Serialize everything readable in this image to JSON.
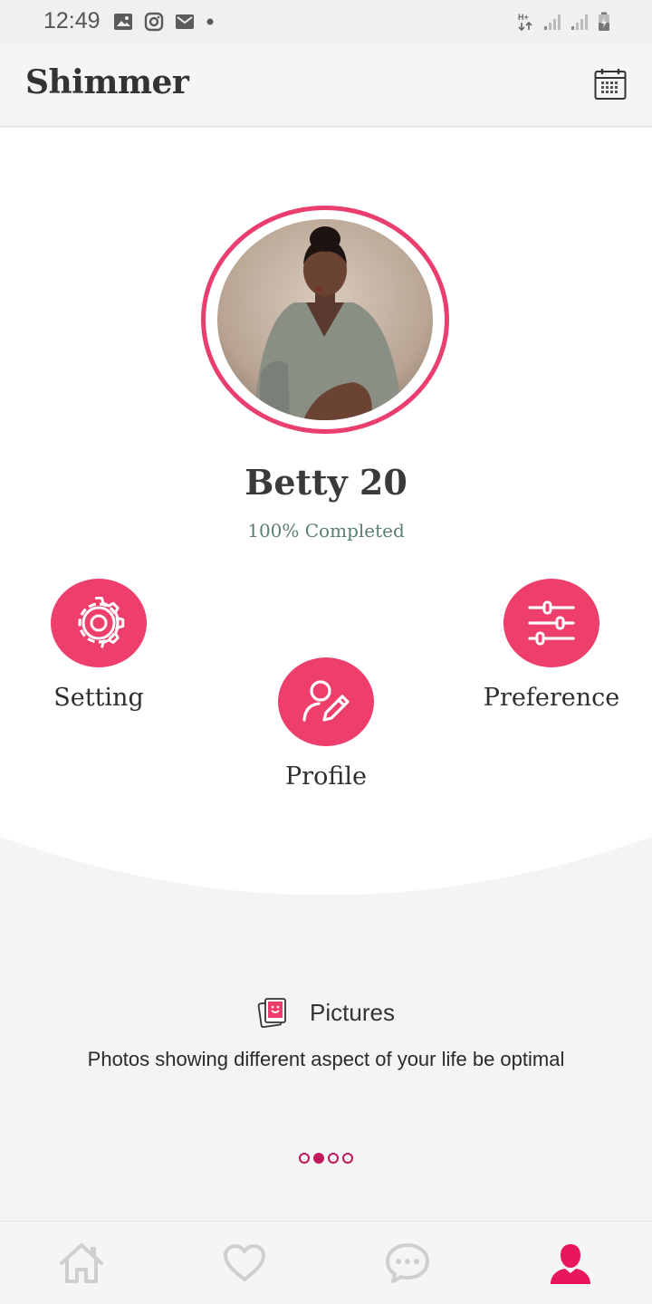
{
  "status_bar": {
    "time": "12:49",
    "left_icons": [
      "image-icon",
      "instagram-icon",
      "gmail-icon",
      "dot-icon"
    ],
    "right_icons": [
      "network-h-plus-icon",
      "signal-icon",
      "signal-icon",
      "battery-icon"
    ]
  },
  "app_bar": {
    "title": "Shimmer",
    "action_icon": "calendar-icon"
  },
  "profile": {
    "name": "Betty 20",
    "completion": "100% Completed",
    "completion_value": 100
  },
  "actions": {
    "setting": {
      "label": "Setting",
      "icon": "gear-icon"
    },
    "profile": {
      "label": "Profile",
      "icon": "edit-profile-icon"
    },
    "preference": {
      "label": "Preference",
      "icon": "sliders-icon"
    }
  },
  "tip": {
    "title": "Pictures",
    "icon": "pictures-icon",
    "description": "Photos showing different aspect of your life be optimal"
  },
  "pager": {
    "count": 4,
    "active_index": 1
  },
  "bottom_nav": {
    "items": [
      "home-icon",
      "heart-icon",
      "chat-icon",
      "user-icon"
    ],
    "active_index": 3
  },
  "colors": {
    "accent": "#ee3f6c",
    "pager": "#c2185b",
    "progress_text": "#5a7f70",
    "nav_inactive": "#cfcfcf"
  }
}
